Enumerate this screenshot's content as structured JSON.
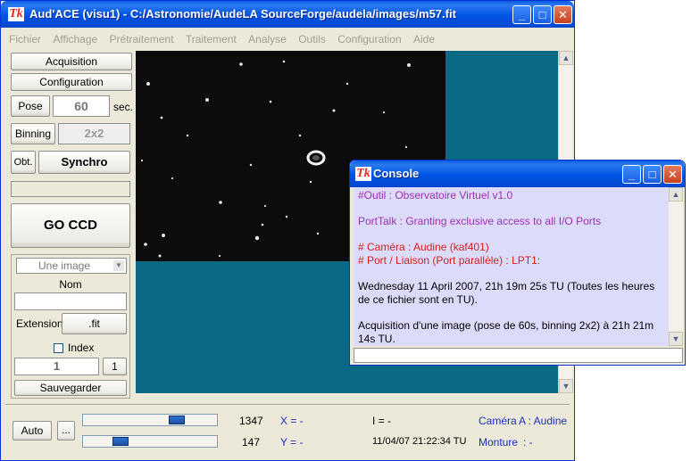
{
  "main": {
    "title": "Aud'ACE (visu1) - C:/Astronomie/AudeLA SourceForge/audela/images/m57.fit",
    "app_icon": "Tk",
    "menu": [
      "Fichier",
      "Affichage",
      "Prétraitement",
      "Traitement",
      "Analyse",
      "Outils",
      "Configuration",
      "Aide"
    ]
  },
  "panel": {
    "acquisition": "Acquisition",
    "configuration": "Configuration",
    "pose_label": "Pose",
    "pose_value": "60",
    "pose_unit": "sec.",
    "binning_label": "Binning",
    "binning_value": "2x2",
    "obt_label": "Obt.",
    "synchro": "Synchro",
    "go_ccd": "GO CCD",
    "mode_select": "Une image",
    "nom_label": "Nom",
    "nom_value": "",
    "extension_label": "Extension",
    "extension_value": ".fit",
    "index_label": "Index",
    "index_value": "1",
    "index_btn": "1",
    "save": "Sauvegarder"
  },
  "status": {
    "auto": "Auto",
    "more": "...",
    "high_value": "1347",
    "low_value": "147",
    "x_label": "X = -",
    "y_label": "Y = -",
    "i_label": "I = -",
    "datetime": "11/04/07 21:22:34 TU",
    "camera": "Caméra",
    "camera_name": "A : Audine",
    "monture": "Monture",
    "monture_value": ": -"
  },
  "console": {
    "title": "Console",
    "lines": [
      {
        "text": "#Outil : Observatoire Virtuel v1.0",
        "color": "#9b2fb0"
      },
      {
        "text": "PortTalk : Granting exclusive access to all I/O Ports",
        "color": "#9b2fb0"
      },
      {
        "text": "# Caméra : Audine (kaf401)",
        "color": "#d81e1e"
      },
      {
        "text": "# Port / Liaison (Port parallèle) : LPT1:",
        "color": "#d81e1e"
      },
      {
        "text": "Wednesday 11 April 2007, 21h 19m 25s TU (Toutes les heures de ce fichier sont en TU).",
        "color": "#000000"
      },
      {
        "text": "Acquisition d'une image (pose de 60s, binning 2x2) à 21h 21m 14s TU.",
        "color": "#000000"
      }
    ]
  },
  "colors": {
    "title_blue": "#0054e3",
    "image_bg": "#0a6a84",
    "console_bg": "#dcdcfa"
  }
}
